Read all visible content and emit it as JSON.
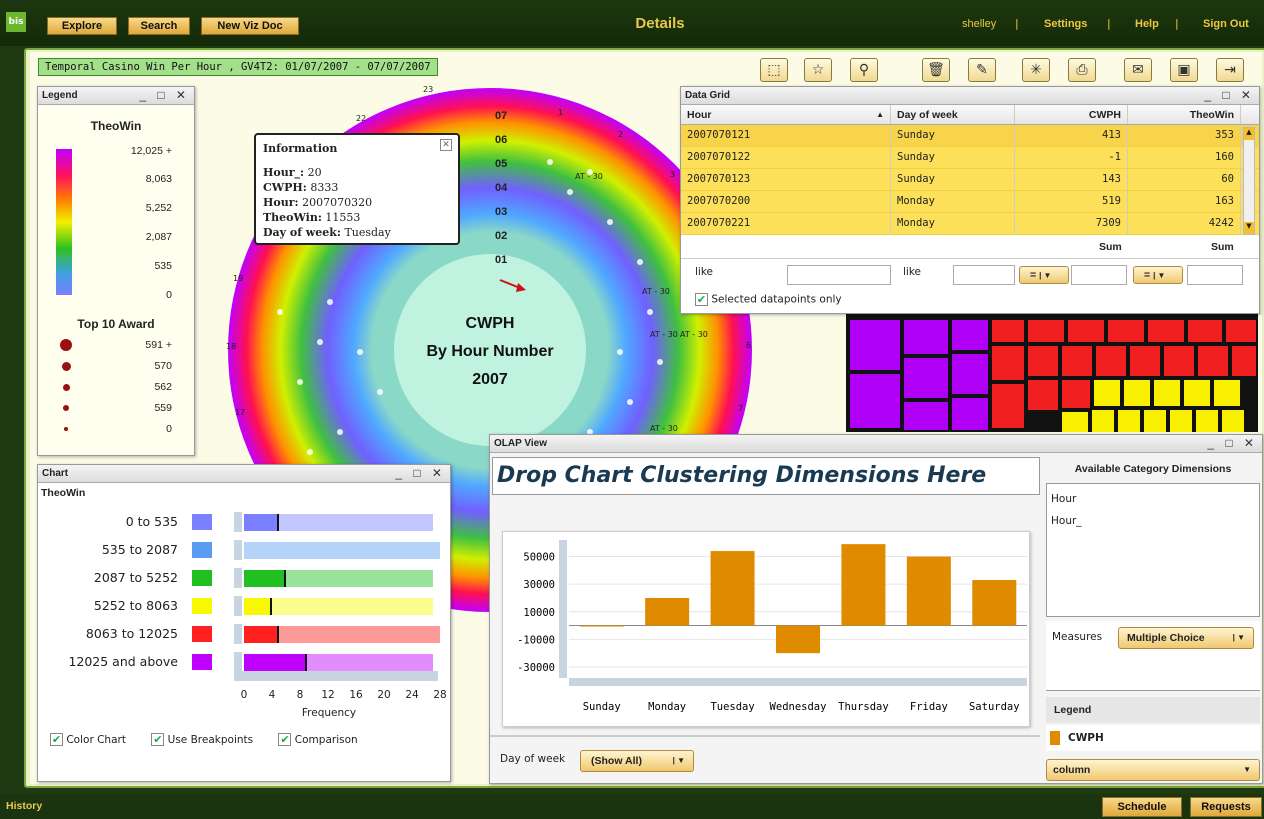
{
  "topbar": {
    "logo": "bis",
    "buttons": [
      "Explore",
      "Search",
      "New Viz Doc"
    ],
    "title": "Details",
    "user": "shelley",
    "links": [
      "Settings",
      "Help",
      "Sign Out"
    ]
  },
  "breadcrumb": "Temporal Casino Win Per Hour , GV4T2: 01/07/2007 - 07/07/2007",
  "toolbar_icons": [
    "select-rect-icon",
    "star-icon",
    "zoom-icon",
    "trash-icon",
    "edit-icon",
    "explode-icon",
    "print-icon",
    "mail-icon",
    "save-icon",
    "exit-icon"
  ],
  "legend": {
    "panel_title": "Legend",
    "title": "TheoWin",
    "ticks": [
      "12,025 +",
      "8,063",
      "5,252",
      "2,087",
      "535",
      "0"
    ],
    "award_title": "Top 10 Award",
    "awards": [
      "591 +",
      "570",
      "562",
      "559",
      "0"
    ]
  },
  "radial": {
    "center_line1": "CWPH",
    "center_line2": "By Hour Number",
    "center_line3": "2007",
    "spoke_labels": [
      "07",
      "06",
      "05",
      "04",
      "03",
      "02",
      "01"
    ],
    "ring_numbers": [
      "23",
      "22",
      "1",
      "2",
      "3",
      "19",
      "18",
      "17",
      "6",
      "7"
    ],
    "at_labels": [
      "AT - 30",
      "AT - 30",
      "AT - 30",
      "AT - 30",
      "AT - 30"
    ]
  },
  "info": {
    "title": "Information",
    "rows": [
      {
        "k": "Hour_:",
        "v": "20"
      },
      {
        "k": "CWPH:",
        "v": "8333"
      },
      {
        "k": "Hour:",
        "v": "2007070320"
      },
      {
        "k": "TheoWin:",
        "v": "11553"
      },
      {
        "k": "Day of week:",
        "v": "Tuesday"
      }
    ]
  },
  "datagrid": {
    "panel_title": "Data Grid",
    "columns": [
      "Hour",
      "Day of week",
      "CWPH",
      "TheoWin"
    ],
    "rows": [
      [
        "2007070121",
        "Sunday",
        "413",
        "353"
      ],
      [
        "2007070122",
        "Sunday",
        "-1",
        "160"
      ],
      [
        "2007070123",
        "Sunday",
        "143",
        "60"
      ],
      [
        "2007070200",
        "Monday",
        "519",
        "163"
      ],
      [
        "2007070221",
        "Monday",
        "7309",
        "4242"
      ]
    ],
    "sum_label": "Sum",
    "filter_like": "like",
    "filter_eq": "=",
    "selected_only": "Selected datapoints only"
  },
  "chart_panel": {
    "panel_title": "Chart",
    "subtitle": "TheoWin",
    "xlabel": "Frequency",
    "options": [
      "Color Chart",
      "Use Breakpoints",
      "Comparison"
    ]
  },
  "olap": {
    "panel_title": "OLAP View",
    "drop_text": "Drop Chart Clustering Dimensions Here",
    "avail_title": "Available Category Dimensions",
    "avail_items": [
      "Hour",
      "Hour_"
    ],
    "measures_label": "Measures",
    "measures_value": "Multiple Choice",
    "legend_title": "Legend",
    "legend_item": "CWPH",
    "chart_type": "column",
    "filter_label": "Day of week",
    "filter_value": "(Show All)"
  },
  "statusbar": {
    "history": "History",
    "buttons": [
      "Schedule",
      "Requests"
    ]
  },
  "colors": {
    "accent": "#e8c74a",
    "bar": "#e08a00",
    "frame": "#7aa83a"
  },
  "chart_data": [
    {
      "type": "bar",
      "orientation": "horizontal",
      "title": "TheoWin",
      "xlabel": "Frequency",
      "xlim": [
        0,
        28
      ],
      "xticks": [
        0,
        4,
        8,
        12,
        16,
        20,
        24,
        28
      ],
      "categories": [
        "0  to  535",
        "535  to  2087",
        "2087  to  5252",
        "5252  to  8063",
        "8063  to  12025",
        "12025 and above"
      ],
      "colors": [
        "#7a80ff",
        "#5a9cf0",
        "#20c020",
        "#f8f800",
        "#ff2020",
        "#c000ff"
      ],
      "values": [
        5,
        0,
        6,
        4,
        5,
        9
      ],
      "comparison": [
        27,
        28,
        27,
        27,
        28,
        27
      ]
    },
    {
      "type": "bar",
      "categories": [
        "Sunday",
        "Monday",
        "Tuesday",
        "Wednesday",
        "Thursday",
        "Friday",
        "Saturday"
      ],
      "series": [
        {
          "name": "CWPH",
          "values": [
            -500,
            20000,
            54000,
            -20000,
            59000,
            50000,
            33000
          ]
        }
      ],
      "yticks": [
        "50000",
        "30000",
        "10000",
        "-10000",
        "-30000"
      ],
      "ylim": [
        -38000,
        62000
      ]
    }
  ]
}
